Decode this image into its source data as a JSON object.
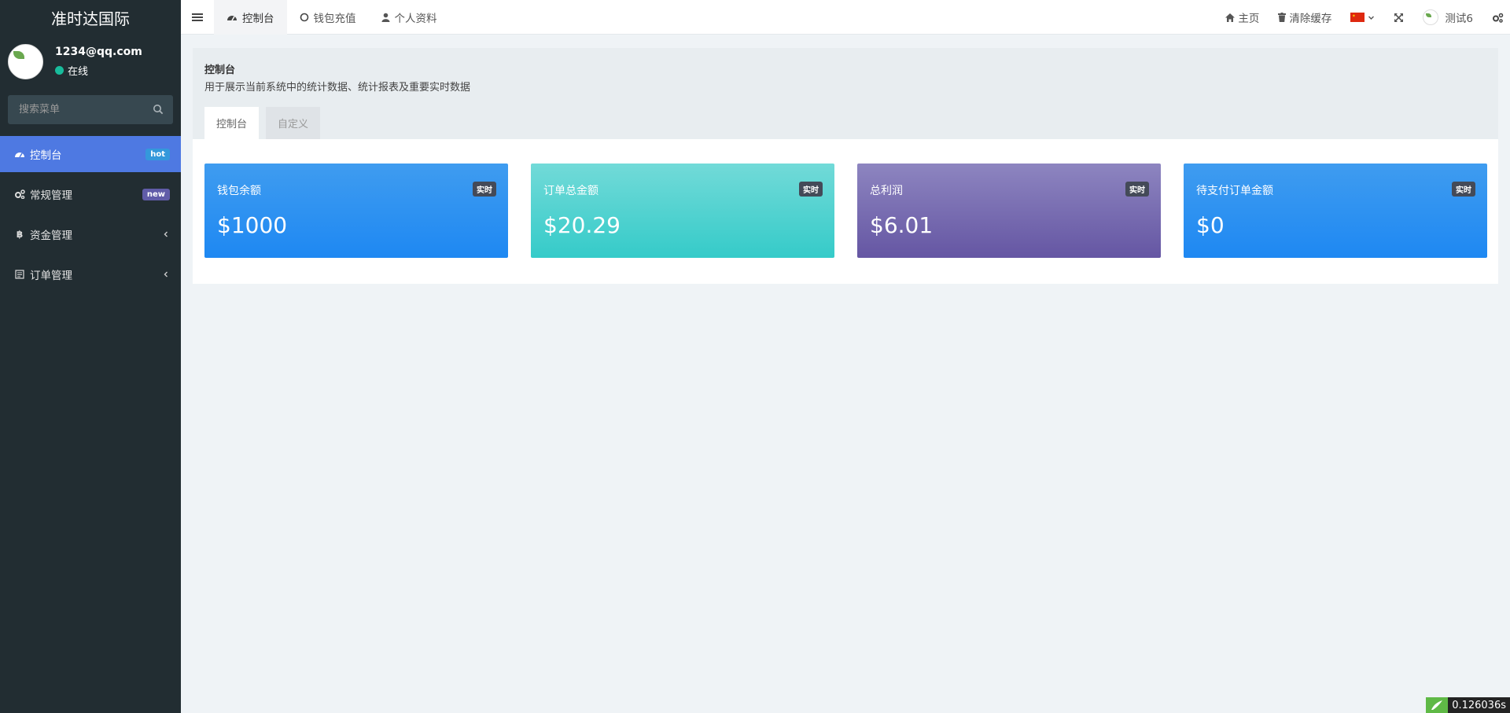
{
  "sidebar": {
    "brand": "准时达国际",
    "user": {
      "name": "1234@qq.com",
      "status": "在线"
    },
    "search_placeholder": "搜索菜单",
    "items": [
      {
        "label": "控制台",
        "badge": "hot",
        "icon": "dashboard-icon"
      },
      {
        "label": "常规管理",
        "badge": "new",
        "icon": "cogs-icon"
      },
      {
        "label": "资金管理",
        "icon": "bitcoin-icon"
      },
      {
        "label": "订单管理",
        "icon": "list-icon"
      }
    ]
  },
  "topbar": {
    "tabs": [
      {
        "label": "控制台",
        "icon": "dashboard-icon"
      },
      {
        "label": "钱包充值",
        "icon": "circle-icon"
      },
      {
        "label": "个人资料",
        "icon": "user-icon"
      }
    ],
    "home": "主页",
    "clear_cache": "清除缓存",
    "language": "zh-CN",
    "username": "测试6"
  },
  "content": {
    "title": "控制台",
    "description": "用于展示当前系统中的统计数据、统计报表及重要实时数据",
    "tabs": [
      "控制台",
      "自定义"
    ],
    "cards": [
      {
        "title": "钱包余额",
        "badge": "实时",
        "value": "$1000",
        "color": "#1e88f2"
      },
      {
        "title": "订单总金额",
        "badge": "实时",
        "value": "$20.29",
        "color": "#35cbc9"
      },
      {
        "title": "总利润",
        "badge": "实时",
        "value": "$6.01",
        "color": "#6556a3"
      },
      {
        "title": "待支付订单金额",
        "badge": "实时",
        "value": "$0",
        "color": "#1e88f2"
      }
    ]
  },
  "footer": {
    "timer": "0.126036s"
  }
}
